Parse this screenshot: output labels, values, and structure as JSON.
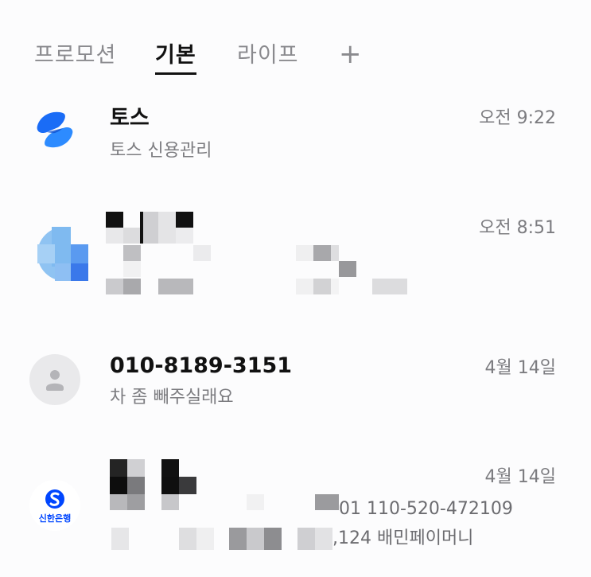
{
  "tabs": [
    {
      "label": "프로모션",
      "active": false
    },
    {
      "label": "기본",
      "active": true
    },
    {
      "label": "라이프",
      "active": false
    }
  ],
  "add_tab_label": "+",
  "messages": [
    {
      "sender": "토스",
      "preview": "토스 신용관리",
      "time": "오전 9:22",
      "avatar_icon": "toss-logo-icon",
      "accent": "#1a6cf6"
    },
    {
      "sender": "",
      "preview": "",
      "time": "오전 8:51",
      "avatar_icon": "pixelated-avatar-icon",
      "redacted": true
    },
    {
      "sender": "010-8189-3151",
      "preview": "차 좀 빼주실래요",
      "time": "4월 14일",
      "avatar_icon": "person-icon"
    },
    {
      "sender": "",
      "preview_line1": "01 110-520-472109",
      "preview_line2": ",124  배민페이머니",
      "time": "4월 14일",
      "avatar_icon": "shinhan-bank-logo-icon",
      "avatar_text": "신한은행",
      "accent": "#0046ff",
      "redacted": true
    }
  ]
}
